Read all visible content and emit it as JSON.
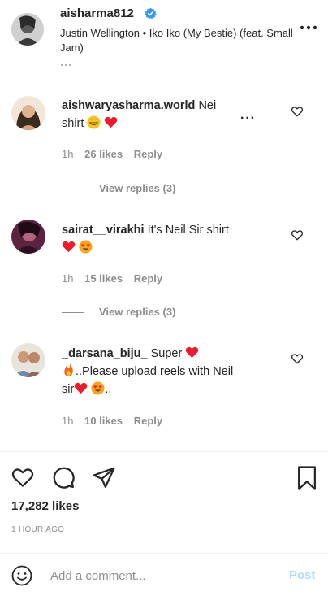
{
  "header": {
    "username": "aisharma812",
    "verified": true,
    "song_line": "Justin Wellington • Iko Iko (My Bestie) (feat. Small Jam)"
  },
  "comments": [
    {
      "username": "aishwaryasharma.world",
      "text_line1": "Nei",
      "text_line2": "shirt",
      "emojis": [
        "grinning-face",
        "red-heart"
      ],
      "time": "1h",
      "likes": "26 likes",
      "reply": "Reply",
      "view_replies": "View replies (3)"
    },
    {
      "username": "sairat__virakhi",
      "text_line1": "It's Neil Sir shirt",
      "emojis": [
        "red-heart",
        "heart-eyes-face"
      ],
      "time": "1h",
      "likes": "15 likes",
      "reply": "Reply",
      "view_replies": "View replies (3)"
    },
    {
      "username": "_darsana_biju_",
      "text_line1": "Super",
      "text_line2": "..Please upload reels with Neil",
      "text_line3": "sir",
      "text_tail": "..",
      "emojis": [
        "red-heart",
        "fire",
        "red-heart",
        "heart-eyes-face"
      ],
      "time": "1h",
      "likes": "10 likes",
      "reply": "Reply"
    }
  ],
  "post": {
    "likes": "17,282 likes",
    "time_ago": "1 HOUR AGO"
  },
  "add_comment": {
    "placeholder": "Add a comment...",
    "post_label": "Post"
  },
  "colors": {
    "text": "#262626",
    "muted": "#8e8e8e",
    "verified_blue": "#3897f0",
    "post_disabled": "#b3dbff",
    "heart_red": "#ed1b2e"
  },
  "icons": [
    "more-icon",
    "verified-icon",
    "heart-icon",
    "comment-icon",
    "share-icon",
    "bookmark-icon",
    "smiley-icon"
  ]
}
